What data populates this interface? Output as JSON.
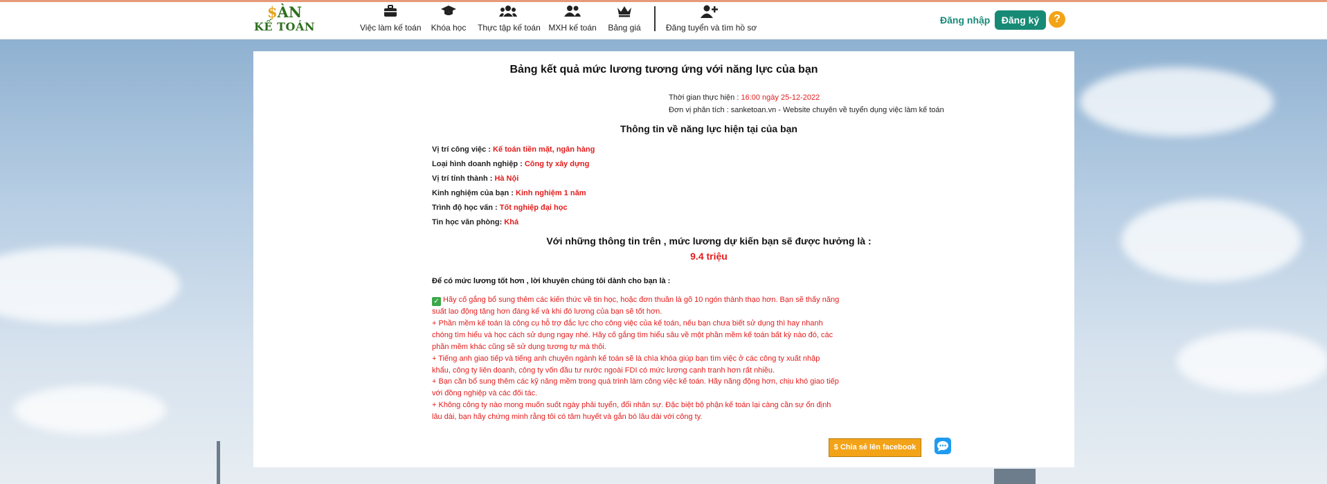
{
  "header": {
    "logo": {
      "line1_symbol": "$",
      "line1_text": "ÀN",
      "line2": "KẾ TOÁN"
    },
    "nav": [
      {
        "label": "Việc làm kế toán",
        "icon": "briefcase-icon"
      },
      {
        "label": "Khóa học",
        "icon": "graduation-cap-icon"
      },
      {
        "label": "Thực tập kế toán",
        "icon": "users-group-icon"
      },
      {
        "label": "MXH kế toán",
        "icon": "user-friends-icon"
      },
      {
        "label": "Bảng giá",
        "icon": "crown-icon"
      },
      {
        "label": "Đăng tuyển và tìm hồ sơ",
        "icon": "user-plus-icon"
      }
    ],
    "login": "Đăng nhập",
    "register": "Đăng ký",
    "help": "?",
    "colors": {
      "brand_green": "#178a75",
      "logo_green": "#2f6e1f",
      "accent_orange": "#f3a317"
    }
  },
  "report": {
    "title": "Bảng kết quả mức lương tương ứng với năng lực của bạn",
    "time_label": "Thời gian thực hiện : ",
    "time_value": "16:00 ngày 25-12-2022",
    "unit_label": "Đơn vị phân tích : ",
    "unit_value": "sanketoan.vn - Website chuyên về tuyển dụng việc làm kế toán",
    "subtitle": "Thông tin về năng lực hiện tại của bạn",
    "fields": [
      {
        "label": "Vị trí công việc : ",
        "value": "Kế toán tiền mặt, ngân hàng"
      },
      {
        "label": "Loại hình doanh nghiệp : ",
        "value": "Công ty xây dựng"
      },
      {
        "label": "Vị trí tỉnh thành : ",
        "value": "Hà Nội"
      },
      {
        "label": "Kinh nghiệm của bạn : ",
        "value": "Kinh nghiệm 1 năm"
      },
      {
        "label": "Trình độ học vấn : ",
        "value": "Tốt nghiệp đại học"
      },
      {
        "label": "Tin học văn phòng: ",
        "value": "Khá"
      }
    ],
    "result_text": "Với những thông tin trên , mức lương dự kiến bạn sẽ được hưởng là :",
    "salary": "9.4 triệu",
    "advice_title": "Để có mức lương tốt hơn , lời khuyên chúng tôi dành cho bạn là :",
    "advice": [
      "Hãy cố gắng bổ sung thêm các kiến thức về tin học, hoặc đơn thuần là gõ 10 ngón thành thạo hơn. Bạn sẽ thấy năng suất lao động tăng hơn đáng kể và khi đó lương của bạn sẽ tốt hơn.",
      "+ Phần mềm kế toán là công cụ hỗ trợ đắc lực cho công việc của kế toán, nếu bạn chưa biết sử dụng thì hay nhanh chóng tìm hiểu và học cách sử dụng ngay nhé. Hãy cố gắng tìm hiểu sâu về một phần mềm kế toán bất kỳ nào đó, các phần mềm khác cũng sẽ sử dụng tương tự mà thôi.",
      "+ Tiếng anh giao tiếp và tiếng anh chuyên ngành kế toán sẽ là chìa khóa giúp bạn tìm việc ở các công ty xuất nhập khẩu, công ty liên doanh, công ty vốn đầu tư nước ngoài FDI có mức lương cạnh tranh hơn rất nhiều.",
      "+ Bạn cần bổ sung thêm các kỹ năng mềm trong quá trình làm công việc kế toán. Hãy năng động hơn, chịu khó giao tiếp với đồng nghiệp và các đối tác.",
      "+ Không công ty nào mong muốn suốt ngày phải tuyển, đổi nhân sự. Đặc biệt bộ phận kế toán lại càng cần sự ổn định lâu dài, bạn hãy chứng minh rằng tôi có tâm huyết và gắn bó lâu dài với công ty."
    ],
    "share_button": "$ Chia sẻ lên facebook",
    "colors": {
      "highlight_red": "#e31b1b",
      "share_orange": "#f3a317",
      "messenger_blue": "#1e9bf0"
    }
  }
}
